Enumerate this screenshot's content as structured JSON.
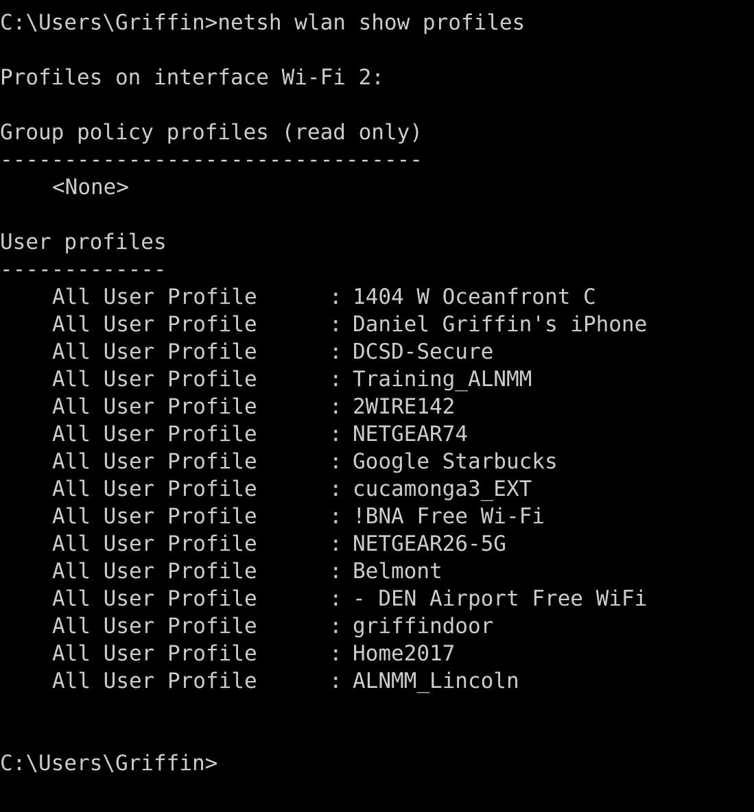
{
  "terminal": {
    "prompt": "C:\\Users\\Griffin>",
    "command": "netsh wlan show profiles",
    "interface_header": "Profiles on interface Wi-Fi 2:",
    "group_policy_header": "Group policy profiles (read only)",
    "group_policy_rule": "---------------------------------",
    "group_policy_none": "<None>",
    "user_profiles_header": "User profiles",
    "user_profiles_rule": "-------------",
    "profile_label": "All User Profile",
    "separator": ":",
    "profiles": [
      "1404 W Oceanfront C",
      "Daniel Griffin's iPhone",
      "DCSD-Secure",
      "Training_ALNMM",
      "2WIRE142",
      "NETGEAR74",
      "Google Starbucks",
      "cucamonga3_EXT",
      "!BNA Free Wi-Fi",
      "NETGEAR26-5G",
      "Belmont",
      "- DEN Airport Free WiFi",
      "griffindoor",
      "Home2017",
      "ALNMM_Lincoln"
    ],
    "final_prompt": "C:\\Users\\Griffin>"
  },
  "colors": {
    "background": "#000000",
    "text": "#cccccc"
  }
}
